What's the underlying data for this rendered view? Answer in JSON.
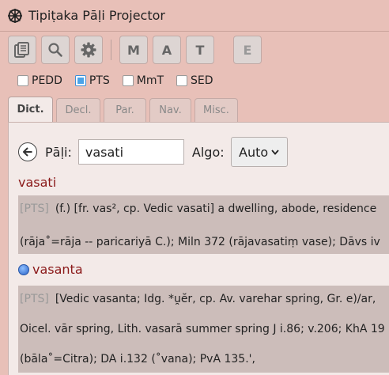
{
  "window": {
    "title": "Tipiṭaka Pāḷi Projector",
    "app_icon": "dharma-wheel-icon"
  },
  "toolbar": {
    "icons": [
      "book-stack-icon",
      "search-icon",
      "gear-icon"
    ],
    "letters": [
      "M",
      "A",
      "T"
    ],
    "extra": "E"
  },
  "dictionaries": [
    {
      "label": "PEDD",
      "checked": false
    },
    {
      "label": "PTS",
      "checked": true
    },
    {
      "label": "MmT",
      "checked": false
    },
    {
      "label": "SED",
      "checked": false
    }
  ],
  "tabs": [
    {
      "label": "Dict.",
      "active": true
    },
    {
      "label": "Decl.",
      "active": false
    },
    {
      "label": "Par.",
      "active": false
    },
    {
      "label": "Nav.",
      "active": false
    },
    {
      "label": "Misc.",
      "active": false
    }
  ],
  "search": {
    "pali_label": "Pāḷi:",
    "query": "vasati",
    "algo_label": "Algo:",
    "algo_value": "Auto"
  },
  "results": [
    {
      "headword": "vasati",
      "source": "[PTS]",
      "lines": [
        "(f.) [fr. vas², cp. Vedic vasati] a dwelling, abode, residence",
        "(rāja˚=rāja -- paricariyā C.); Miln 372 (rājavasatiṃ vase); Dāvs iv"
      ]
    },
    {
      "headword": "vasanta",
      "source": "[PTS]",
      "lines": [
        "[Vedic vasanta; Idg. *u̯ĕr, cp. Av. varehar spring, Gr. e)/ar,",
        "Oicel. vār spring, Lith. vasarā summer spring J i.86; v.206; KhA 19",
        "(bāla˚=Citra); DA i.132 (˚vana); PvA 135.',"
      ]
    }
  ]
}
